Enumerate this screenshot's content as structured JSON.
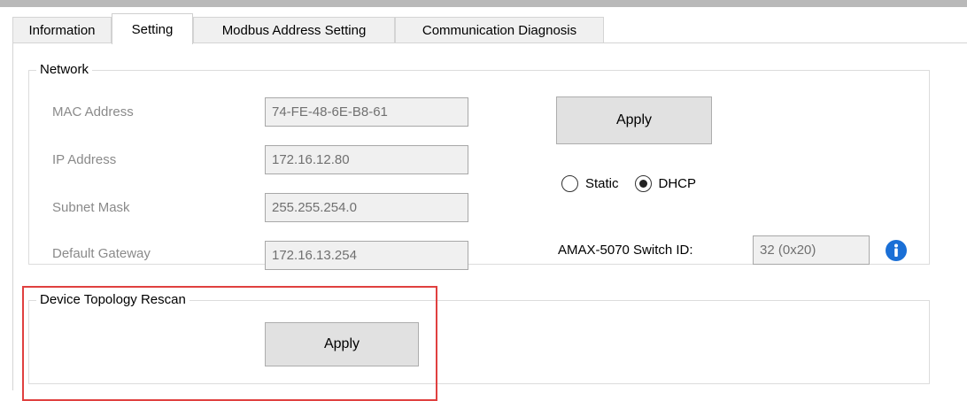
{
  "tabs": [
    {
      "label": "Information",
      "active": false
    },
    {
      "label": "Setting",
      "active": true
    },
    {
      "label": "Modbus Address Setting",
      "active": false
    },
    {
      "label": "Communication Diagnosis",
      "active": false
    }
  ],
  "network": {
    "title": "Network",
    "mac_label": "MAC Address",
    "mac_value": "74-FE-48-6E-B8-61",
    "ip_label": "IP Address",
    "ip_value": "172.16.12.80",
    "subnet_label": "Subnet Mask",
    "subnet_value": "255.255.254.0",
    "gateway_label": "Default Gateway",
    "gateway_value": "172.16.13.254",
    "apply_label": "Apply",
    "static_label": "Static",
    "dhcp_label": "DHCP",
    "selected_mode": "DHCP",
    "switch_id_label": "AMAX-5070 Switch ID:",
    "switch_id_value": "32 (0x20)",
    "info_icon": "info-icon"
  },
  "topology": {
    "title": "Device Topology Rescan",
    "apply_label": "Apply"
  },
  "colors": {
    "highlight": "#e0403f",
    "info_blue": "#1a6fd6"
  }
}
